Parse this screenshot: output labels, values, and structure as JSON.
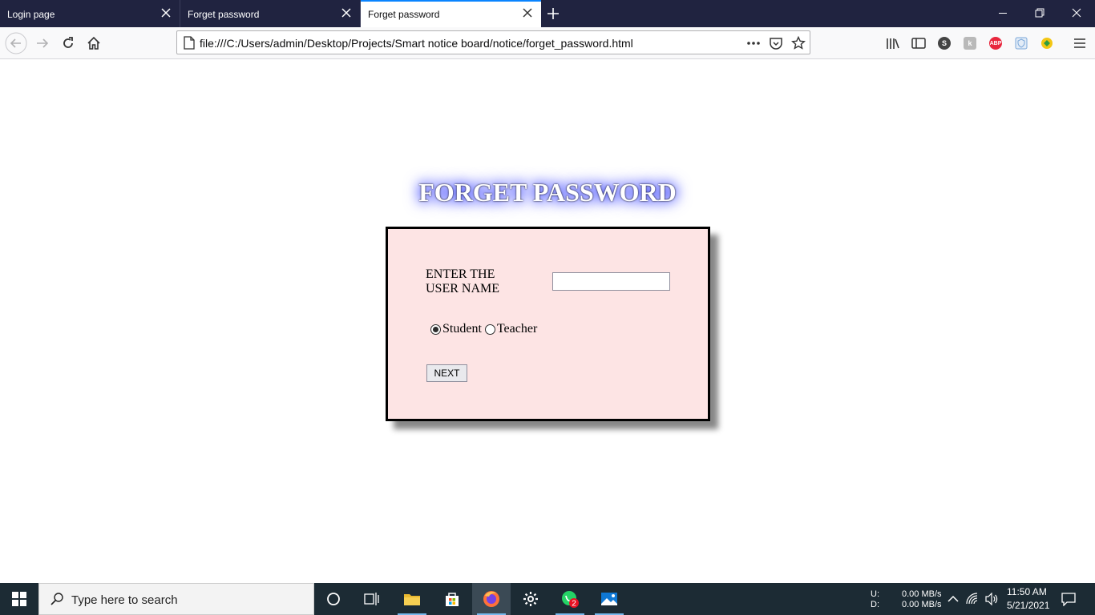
{
  "browser": {
    "tabs": [
      {
        "title": "Login page",
        "active": false
      },
      {
        "title": "Forget password",
        "active": false
      },
      {
        "title": "Forget password",
        "active": true
      }
    ],
    "url": "file:///C:/Users/admin/Desktop/Projects/Smart notice board/notice/forget_password.html",
    "extensions": [
      {
        "name": "s-icon",
        "text": "S",
        "color": "#444"
      },
      {
        "name": "k-icon",
        "text": "k",
        "color": "#aaa"
      },
      {
        "name": "adblock-plus-icon",
        "text": "ABP",
        "color": "#e8263d"
      },
      {
        "name": "shield-icon",
        "text": "",
        "color": "#7aa7d9"
      },
      {
        "name": "green-extension-icon",
        "text": "",
        "color": "#f3c613"
      }
    ]
  },
  "page": {
    "heading": "FORGET PASSWORD",
    "username_label_line1": "ENTER THE",
    "username_label_line2": "USER NAME",
    "username_value": "",
    "role_options": [
      {
        "label": "Student",
        "selected": true
      },
      {
        "label": "Teacher",
        "selected": false
      }
    ],
    "next_button": "NEXT"
  },
  "taskbar": {
    "search_placeholder": "Type here to search",
    "whatsapp_badge": "2",
    "net_up_label": "U:",
    "net_down_label": "D:",
    "net_up_value": "0.00 MB/s",
    "net_down_value": "0.00 MB/s",
    "time": "11:50 AM",
    "date": "5/21/2021"
  }
}
